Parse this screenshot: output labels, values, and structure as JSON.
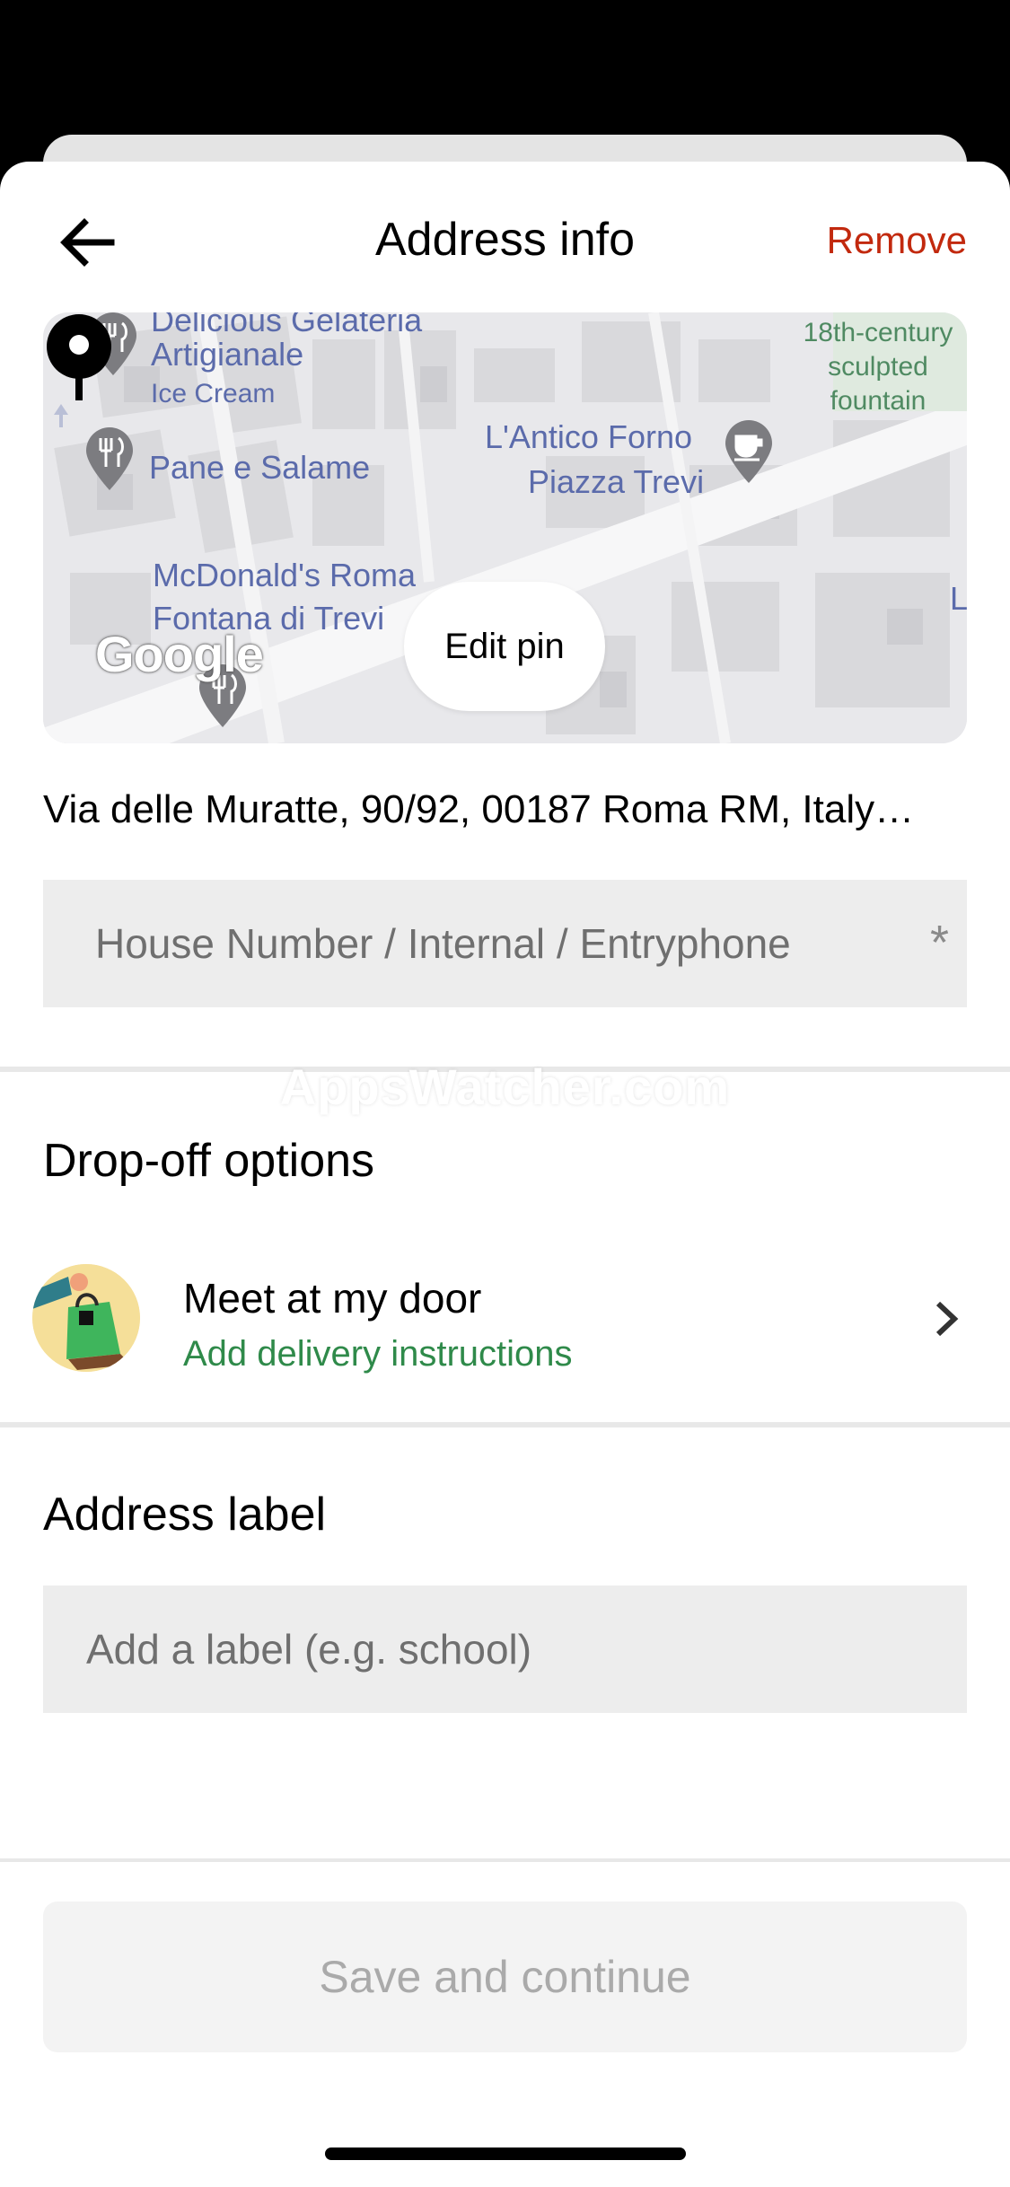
{
  "header": {
    "title": "Address info",
    "remove_label": "Remove"
  },
  "map": {
    "labels": {
      "gelateria_partial": "Delicious Gelateria",
      "artigianale": "Artigianale",
      "ice_cream": "Ice Cream",
      "pane_salame": "Pane e Salame",
      "antico_forno_1": "L'Antico Forno",
      "antico_forno_2": "Piazza Trevi",
      "mcdonalds_1": "McDonald's Roma",
      "mcdonalds_2": "Fontana di Trevi",
      "fountain": "18th-century sculpted fountain",
      "edge_letter": "L"
    },
    "google_logo": "Google",
    "edit_pin_label": "Edit pin"
  },
  "address": {
    "line": "Via delle Muratte, 90/92, 00187 Roma RM, Italy…"
  },
  "house_field": {
    "placeholder": "House Number / Internal / Entryphone",
    "required_mark": "*"
  },
  "watermark": "AppsWatcher.com",
  "dropoff": {
    "section_title": "Drop-off options",
    "option_title": "Meet at my door",
    "option_subtitle": "Add delivery instructions"
  },
  "address_label": {
    "section_title": "Address label",
    "placeholder": "Add a label (e.g. school)"
  },
  "save_label": "Save and continue",
  "colors": {
    "remove": "#c2290e",
    "subtitle_green": "#2f8a4a",
    "field_bg": "#ededed"
  }
}
